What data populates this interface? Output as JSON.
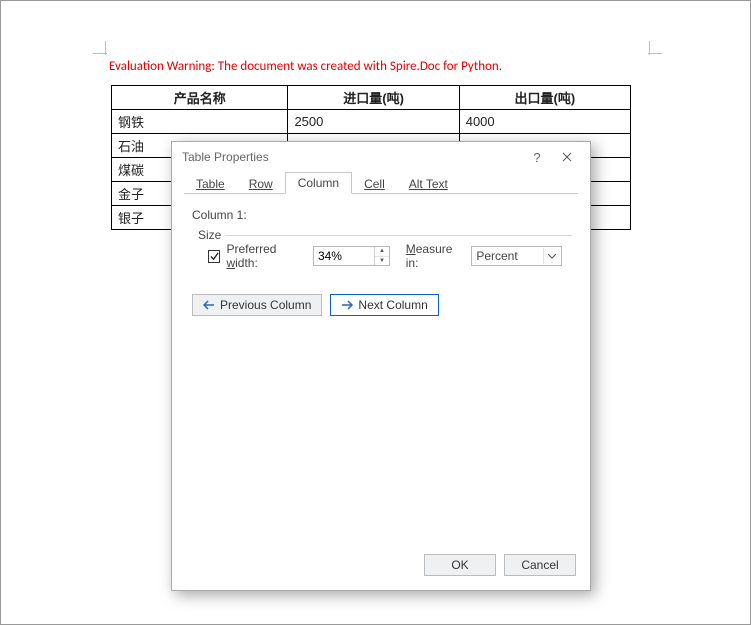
{
  "doc": {
    "warning": "Evaluation Warning: The document was created with Spire.Doc for Python.",
    "table": {
      "headers": [
        "产品名称",
        "进口量(吨)",
        "出口量(吨)"
      ],
      "rows": [
        [
          "钢铁",
          "2500",
          "4000"
        ],
        [
          "石油",
          "",
          ""
        ],
        [
          "煤碳",
          "",
          ""
        ],
        [
          "金子",
          "",
          ""
        ],
        [
          "银子",
          "",
          ""
        ]
      ]
    }
  },
  "dialog": {
    "title": "Table Properties",
    "help_symbol": "?",
    "tabs": {
      "table": "Table",
      "row": "Row",
      "column": "Column",
      "cell": "Cell",
      "alttext": "Alt Text"
    },
    "column_panel": {
      "heading": "Column 1:",
      "group_title": "Size",
      "preferred_width_checked": true,
      "preferred_width_label_pre": "Preferred ",
      "preferred_width_label_u": "w",
      "preferred_width_label_post": "idth:",
      "preferred_width_value": "34%",
      "measure_in_label_u": "M",
      "measure_in_label_post": "easure in:",
      "measure_in_value": "Percent",
      "prev_label_u": "P",
      "prev_label_post": "revious Column",
      "next_label_u": "N",
      "next_label_post": "ext Column"
    },
    "footer": {
      "ok": "OK",
      "cancel": "Cancel"
    }
  }
}
